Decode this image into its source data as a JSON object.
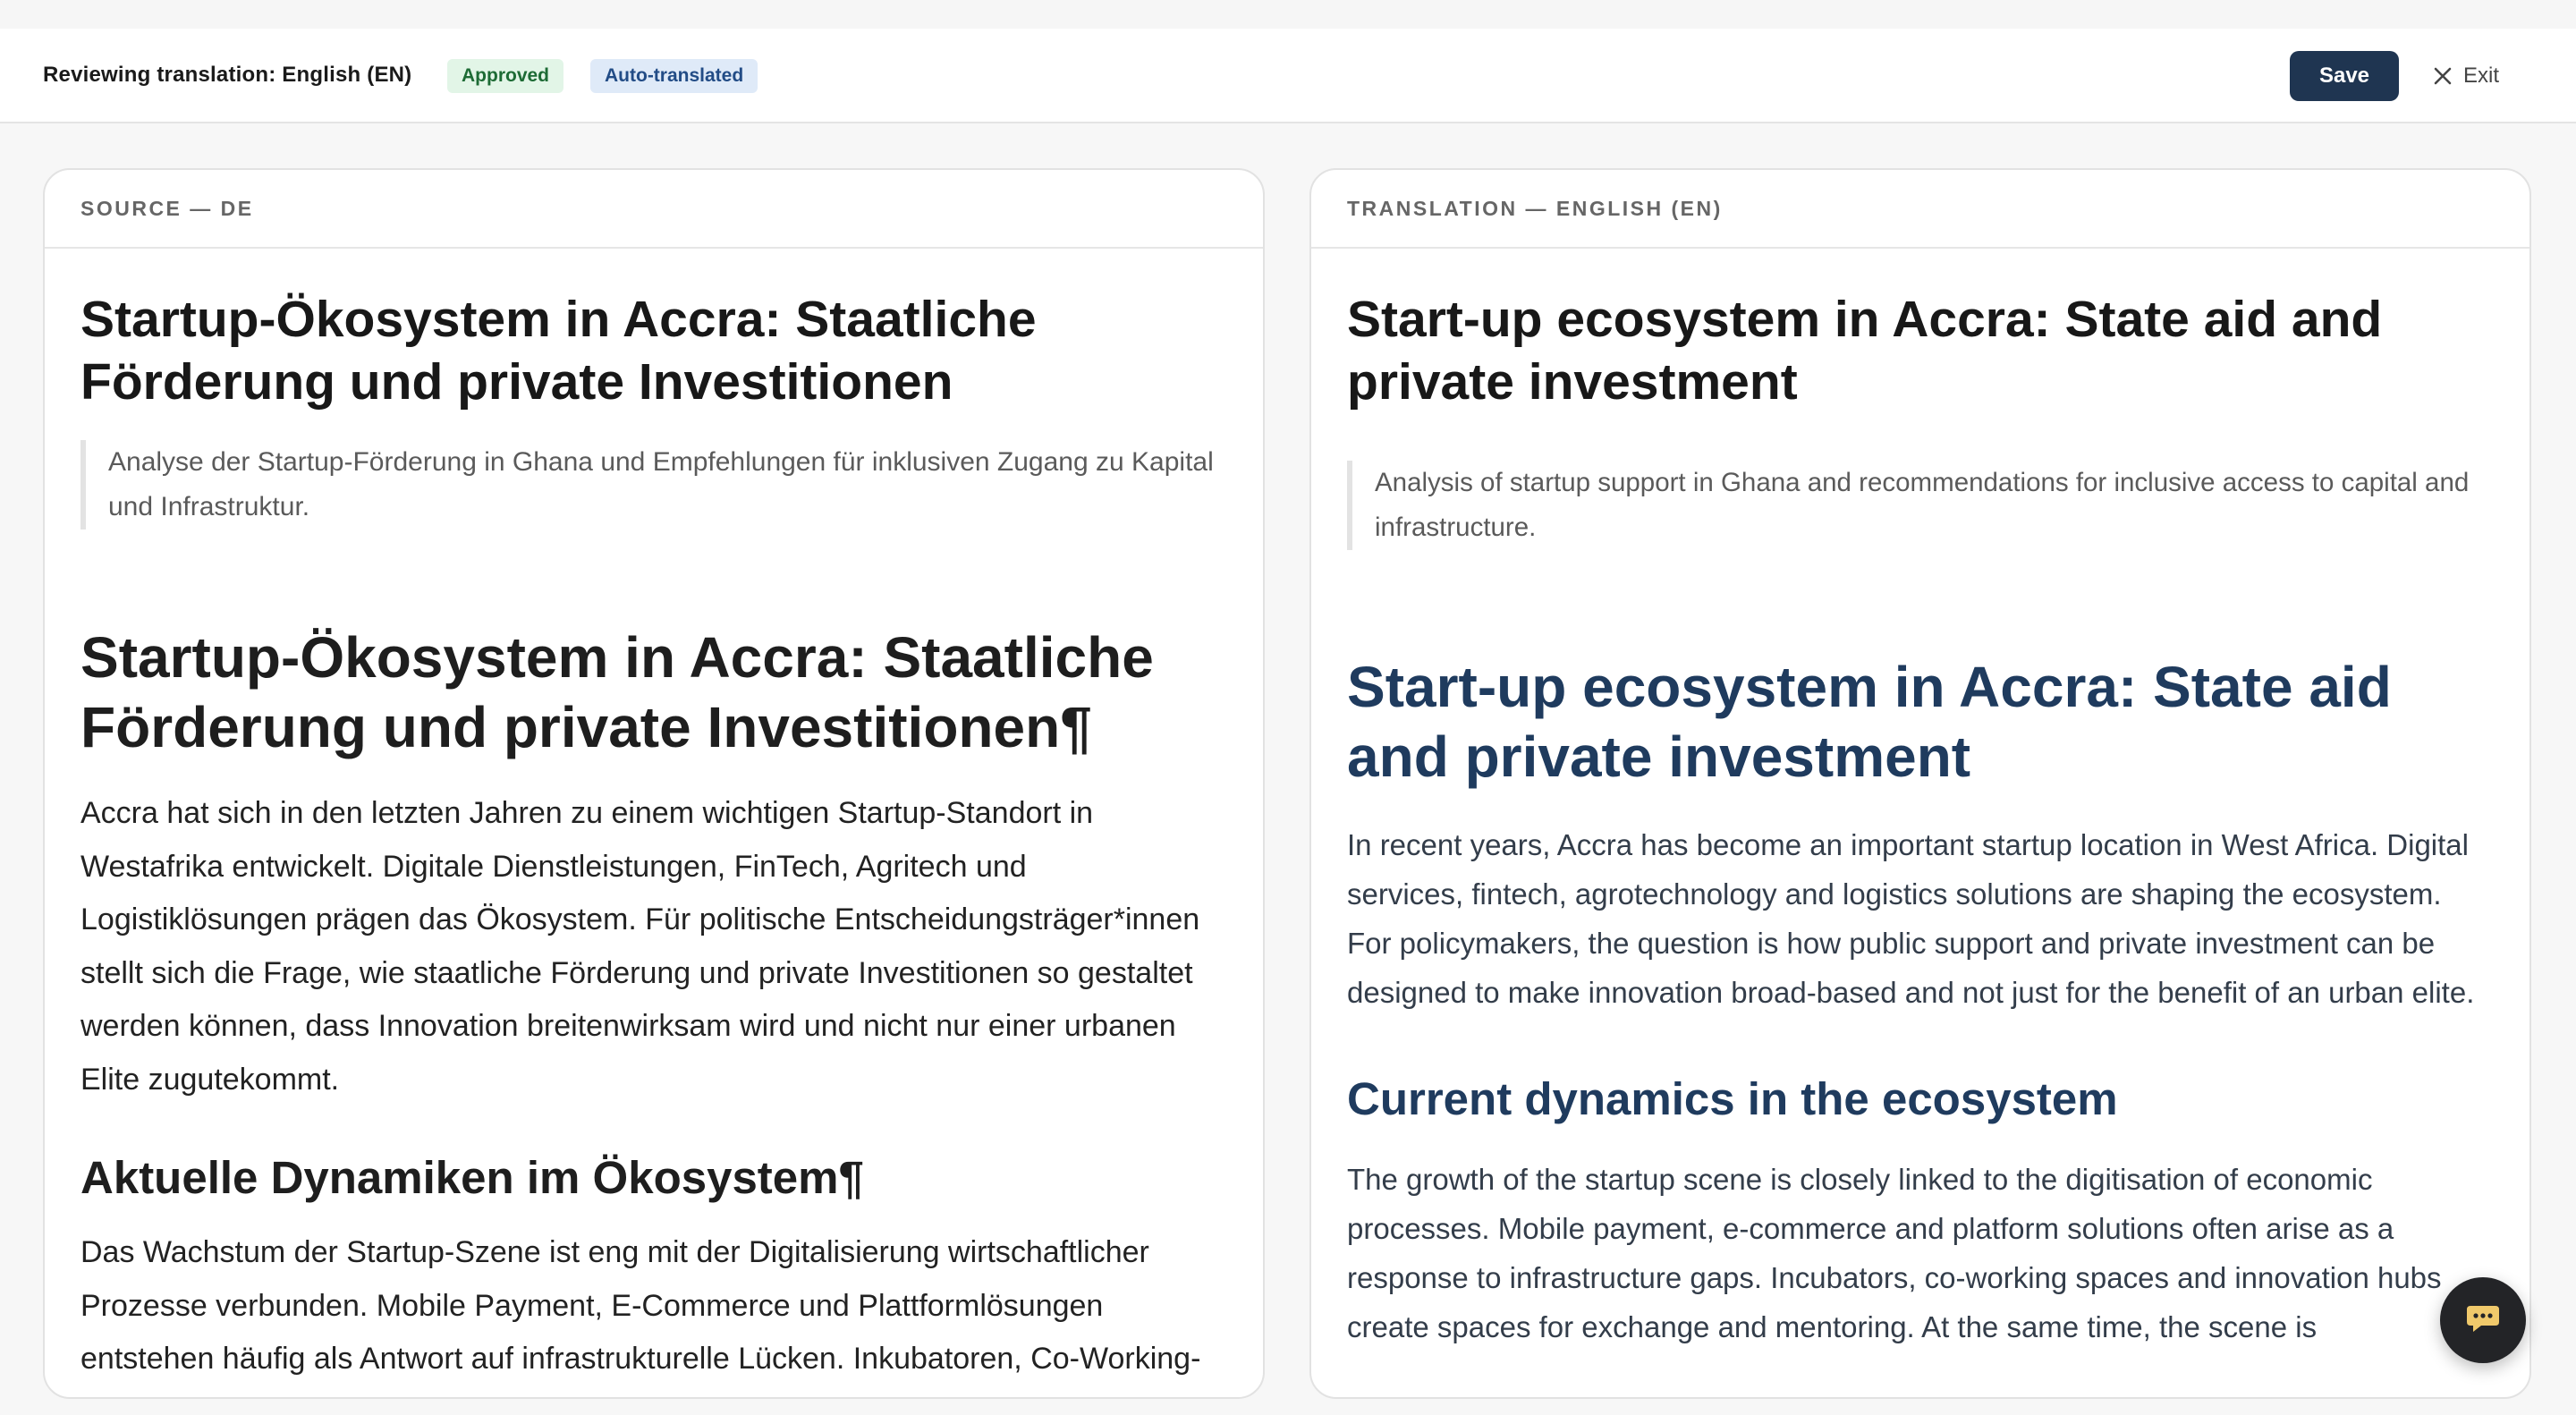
{
  "header": {
    "title": "Reviewing translation: English (EN)",
    "badges": {
      "approved": "Approved",
      "auto": "Auto-translated"
    },
    "save_label": "Save",
    "exit_label": "Exit"
  },
  "source": {
    "panel_label": "SOURCE — DE",
    "doc_title": "Startup-Ökosystem in Accra: Staatliche Förderung und private Investitionen",
    "summary": "Analyse der Startup-Förderung in Ghana und Empfehlungen für inklusiven Zugang zu Kapital und Infrastruktur.",
    "h1": "Startup-Ökosystem in Accra: Staatliche Förderung und private Investitionen¶",
    "para1": "Accra hat sich in den letzten Jahren zu einem wichtigen Startup-Standort in Westafrika entwickelt. Digitale Dienstleistungen, FinTech, Agritech und Logistiklösungen prägen das Ökosystem. Für politische Entscheidungsträger*innen stellt sich die Frage, wie staatliche Förderung und private Investitionen so gestaltet werden können, dass Innovation breitenwirksam wird und nicht nur einer urbanen Elite zugutekommt.",
    "h2": "Aktuelle Dynamiken im Ökosystem¶",
    "para2": "Das Wachstum der Startup-Szene ist eng mit der Digitalisierung wirtschaftlicher Prozesse verbunden. Mobile Payment, E-Commerce und Plattformlösungen entstehen häufig als Antwort auf infrastrukturelle Lücken. Inkubatoren, Co-Working-"
  },
  "translation": {
    "panel_label": "TRANSLATION — ENGLISH (EN)",
    "doc_title": "Start-up ecosystem in Accra: State aid and private investment",
    "summary": "Analysis of startup support in Ghana and recommendations for inclusive access to capital and infrastructure.",
    "h1": "Start-up ecosystem in Accra: State aid and private investment",
    "para1": "In recent years, Accra has become an important startup location in West Africa. Digital services, fintech, agrotechnology and logistics solutions are shaping the ecosystem. For policymakers, the question is how public support and private investment can be designed to make innovation broad-based and not just for the benefit of an urban elite.",
    "h2": "Current dynamics in the ecosystem",
    "para2": "The growth of the startup scene is closely linked to the digitisation of economic processes. Mobile payment, e-commerce and platform solutions often arise as a response to infrastructure gaps. Incubators, co-working spaces and innovation hubs create spaces for exchange and mentoring. At the same time, the scene is"
  },
  "icons": {
    "exit": "close-icon",
    "chat": "chat-bubble-icon"
  },
  "colors": {
    "save_button": "#1f3551",
    "approved_badge_bg": "#e2f5e7",
    "auto_badge_bg": "#dfeaf8",
    "translation_heading": "#1f3b5e"
  }
}
